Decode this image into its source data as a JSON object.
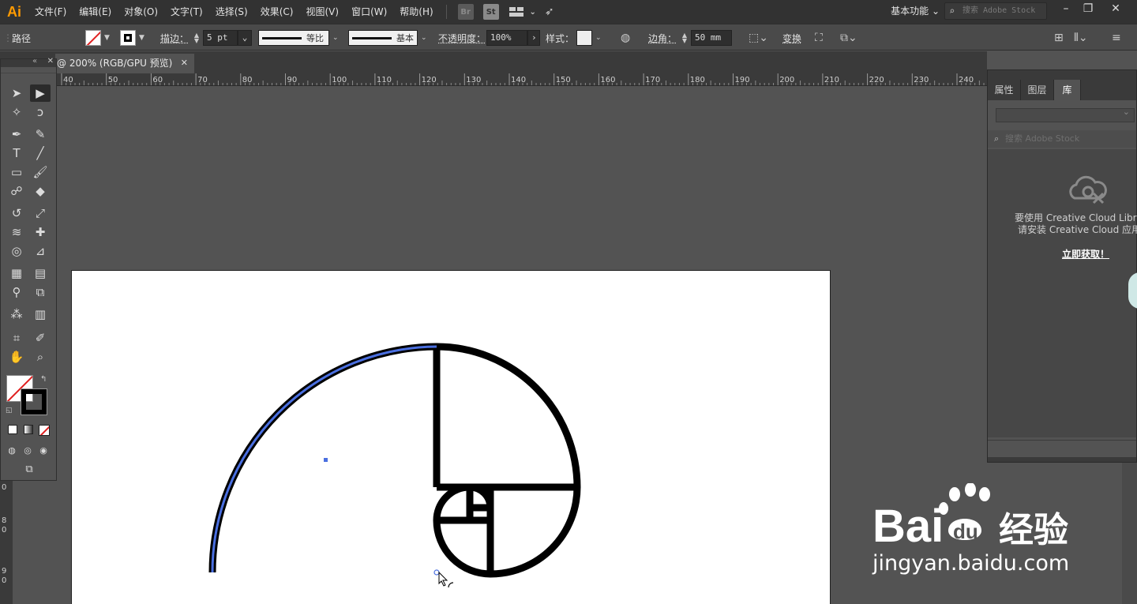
{
  "app": {
    "logo": "Ai"
  },
  "menu": {
    "items": [
      "文件(F)",
      "编辑(E)",
      "对象(O)",
      "文字(T)",
      "选择(S)",
      "效果(C)",
      "视图(V)",
      "窗口(W)",
      "帮助(H)"
    ],
    "bridge": "Br",
    "stock": "St",
    "workspace": "基本功能",
    "stock_search_placeholder": "搜索 Adobe Stock"
  },
  "control": {
    "selection_label": "路径",
    "stroke_label": "描边：",
    "stroke_weight": "5 pt",
    "profile_label": "等比",
    "brush_label": "基本",
    "opacity_label": "不透明度：",
    "opacity_value": "100%",
    "style_label": "样式：",
    "corner_label": "边角：",
    "corner_value": "50 mm",
    "transform_label": "变换"
  },
  "document": {
    "tab_title": "@ 200% (RGB/GPU 预览)"
  },
  "ruler": {
    "ticks": [
      "40",
      "50",
      "60",
      "70",
      "80",
      "90",
      "100",
      "110",
      "120",
      "130",
      "140",
      "150",
      "160",
      "170",
      "180",
      "190",
      "200",
      "210",
      "220",
      "230",
      "240"
    ]
  },
  "vruler": {
    "ticks": [
      "0",
      "8",
      "0",
      "9",
      "0"
    ]
  },
  "panel": {
    "tabs": [
      "属性",
      "图层",
      "库"
    ],
    "active_tab": "库",
    "search_placeholder": "搜索 Adobe Stock",
    "message_line1": "要使用 Creative Cloud Librari",
    "message_line2": "请安装 Creative Cloud 应用程",
    "link": "立即获取！"
  },
  "watermark": {
    "brand": "Bai du 经验",
    "url": "jingyan.baidu.com"
  },
  "colors": {
    "selection_blue": "#4a6fe0",
    "logo_orange": "#ff9a00",
    "artboard": "#ffffff"
  }
}
